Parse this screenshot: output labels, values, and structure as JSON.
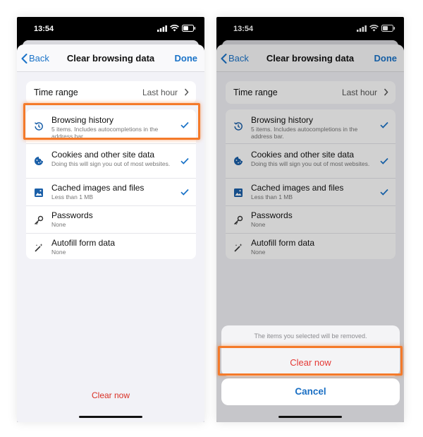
{
  "status": {
    "time": "13:54"
  },
  "nav": {
    "back": "Back",
    "title": "Clear browsing data",
    "done": "Done"
  },
  "time_range": {
    "label": "Time range",
    "value": "Last hour"
  },
  "items": [
    {
      "title": "Browsing history",
      "subtitle": "5 items. Includes autocompletions in the address bar.",
      "checked": true,
      "icon": "history-icon"
    },
    {
      "title": "Cookies and other site data",
      "subtitle": "Doing this will sign you out of most websites.",
      "checked": true,
      "icon": "cookie-icon"
    },
    {
      "title": "Cached images and files",
      "subtitle": "Less than 1 MB",
      "checked": true,
      "icon": "image-icon"
    },
    {
      "title": "Passwords",
      "subtitle": "None",
      "checked": false,
      "icon": "key-icon"
    },
    {
      "title": "Autofill form data",
      "subtitle": "None",
      "checked": false,
      "icon": "magic-wand-icon"
    }
  ],
  "clear_link": "Clear now",
  "action_sheet": {
    "message": "The items you selected will be removed.",
    "clear": "Clear now",
    "cancel": "Cancel"
  },
  "colors": {
    "accent": "#1a73c8",
    "danger": "#d93025",
    "highlight": "#f47a2a"
  }
}
